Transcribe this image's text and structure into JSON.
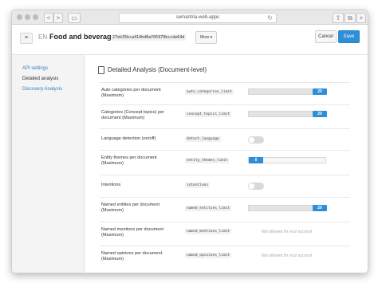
{
  "browser": {
    "address": "semantria-web-apps",
    "nav_back": "<",
    "nav_forward": ">",
    "reload_glyph": "↻",
    "btn_share": "⇧",
    "btn_tabs": "⧉",
    "btn_add": "+"
  },
  "header": {
    "menu_glyph": "≡",
    "language": "EN",
    "title": "Food and beverage",
    "api_key": "27eb35bca414bd8af05979bccde64d",
    "more_label": "More",
    "more_caret": "▾",
    "cancel_label": "Cancel",
    "save_label": "Save"
  },
  "sidebar": {
    "items": [
      {
        "label": "API settings",
        "active": false
      },
      {
        "label": "Detailed analysis",
        "active": true
      },
      {
        "label": "Discovery Analysis",
        "active": false
      }
    ]
  },
  "main": {
    "section_title": "Detailed Analysis (Document-level)",
    "rows": [
      {
        "label": "Auto categories per document (Maximum)",
        "key": "auto_categories_limit",
        "kind": "slider",
        "value": "20",
        "fraction": 1.0
      },
      {
        "label": "Categories (Concept topics) per document (Maximum)",
        "key": "concept_topics_limit",
        "kind": "slider",
        "value": "20",
        "fraction": 1.0
      },
      {
        "label": "Language detection (on/off)",
        "key": "detect_language",
        "kind": "toggle",
        "state": "off"
      },
      {
        "label": "Entity themes per document (Maximum)",
        "key": "entity_themes_limit",
        "kind": "slider",
        "value": "0",
        "fraction": 0.0
      },
      {
        "label": "Intentions",
        "key": "intentions",
        "kind": "toggle",
        "state": "off"
      },
      {
        "label": "Named entities per document (Maximum)",
        "key": "named_entities_limit",
        "kind": "slider",
        "value": "20",
        "fraction": 1.0
      },
      {
        "label": "Named mentions per document (Maximum)",
        "key": "named_mentions_limit",
        "kind": "text",
        "note": "Not allowed for your account"
      },
      {
        "label": "Named opinions per document (Maximum)",
        "key": "named_opinions_limit",
        "kind": "text",
        "note": "Not allowed for your account"
      }
    ]
  },
  "colors": {
    "accent": "#2e8fd9",
    "link": "#2e7fc8"
  }
}
